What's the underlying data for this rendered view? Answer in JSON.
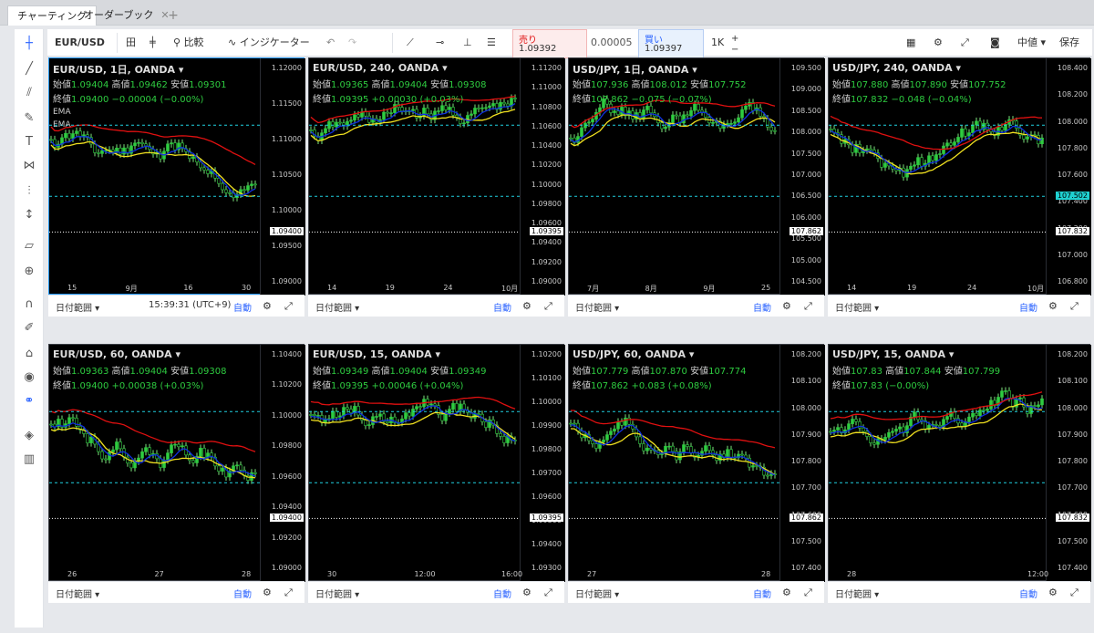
{
  "tabs": [
    {
      "label": "チャーティング",
      "close": ""
    },
    {
      "label": "オーダーブック",
      "close": "✕"
    }
  ],
  "toolbar": {
    "symbol": "EUR/USD",
    "compare": "比較",
    "indicators": "インジケーター",
    "sell_label": "売り",
    "sell_price": "1.09392",
    "spread": "0.00005",
    "buy_label": "買い",
    "buy_price": "1.09397",
    "lot": "1K",
    "price_type": "中値",
    "save": "保存"
  },
  "icons": {
    "crosshair": "crosshair-icon",
    "trendline": "trendline-icon",
    "fib": "fib-icon",
    "brush": "brush-icon",
    "text": "text-icon",
    "pattern": "pattern-icon",
    "projection": "projection-icon",
    "measure": "measure-icon",
    "ruler": "ruler-icon",
    "zoom": "zoom-in-icon",
    "magnet": "magnet-icon",
    "lock-draw": "pencil-lock-icon",
    "lock": "lock-icon",
    "eye": "eye-icon",
    "link": "link-icon",
    "layers": "layers-icon",
    "trash": "trash-icon"
  },
  "panes": [
    {
      "title": "EUR/USD, 1日, OANDA",
      "o": "1.09404",
      "h": "1.09462",
      "l": "1.09301",
      "c": "1.09400",
      "chg": "−0.00004 (−0.00%)",
      "ema1": "EMA",
      "ema2": "EMA",
      "yticks": [
        "1.12000",
        "1.11500",
        "1.11000",
        "1.10500",
        "1.10000",
        "1.09500",
        "1.09000"
      ],
      "xticks": [
        "15",
        "9月",
        "16",
        "30"
      ],
      "last": "1.09400",
      "range": "日付範囲",
      "clock": "15:39:31 (UTC+9)",
      "auto": "自動"
    },
    {
      "title": "EUR/USD, 240, OANDA",
      "o": "1.09365",
      "h": "1.09404",
      "l": "1.09308",
      "c": "1.09395",
      "chg": "+0.00030 (+0.03%)",
      "yticks": [
        "1.11200",
        "1.11000",
        "1.10800",
        "1.10600",
        "1.10400",
        "1.10200",
        "1.10000",
        "1.09800",
        "1.09600",
        "1.09400",
        "1.09200",
        "1.09000"
      ],
      "xticks": [
        "14",
        "19",
        "24",
        "10月"
      ],
      "last": "1.09395",
      "range": "日付範囲",
      "auto": "自動"
    },
    {
      "title": "USD/JPY, 1日, OANDA",
      "o": "107.936",
      "h": "108.012",
      "l": "107.752",
      "c": "107.862",
      "chg": "−0.075 (−0.07%)",
      "yticks": [
        "109.500",
        "109.000",
        "108.500",
        "108.000",
        "107.500",
        "107.000",
        "106.500",
        "106.000",
        "105.500",
        "105.000",
        "104.500"
      ],
      "xticks": [
        "7月",
        "8月",
        "9月",
        "25"
      ],
      "last": "107.862",
      "range": "日付範囲",
      "auto": "自動"
    },
    {
      "title": "USD/JPY, 240, OANDA",
      "o": "107.880",
      "h": "107.890",
      "l": "107.752",
      "c": "107.832",
      "chg": "−0.048 (−0.04%)",
      "yticks": [
        "108.400",
        "108.200",
        "108.000",
        "107.800",
        "107.600",
        "107.400",
        "107.200",
        "107.000",
        "106.800"
      ],
      "xticks": [
        "14",
        "19",
        "24",
        "10月"
      ],
      "last": "107.832",
      "last2": "107.502",
      "range": "日付範囲",
      "auto": "自動"
    },
    {
      "title": "EUR/USD, 60, OANDA",
      "o": "1.09363",
      "h": "1.09404",
      "l": "1.09308",
      "c": "1.09400",
      "chg": "+0.00038 (+0.03%)",
      "yticks": [
        "1.10400",
        "1.10200",
        "1.10000",
        "1.09800",
        "1.09600",
        "1.09400",
        "1.09200",
        "1.09000"
      ],
      "xticks": [
        "26",
        "27",
        "28"
      ],
      "last": "1.09400",
      "range": "日付範囲",
      "auto": "自動"
    },
    {
      "title": "EUR/USD, 15, OANDA",
      "o": "1.09349",
      "h": "1.09404",
      "l": "1.09349",
      "c": "1.09395",
      "chg": "+0.00046 (+0.04%)",
      "yticks": [
        "1.10200",
        "1.10100",
        "1.10000",
        "1.09900",
        "1.09800",
        "1.09700",
        "1.09600",
        "1.09500",
        "1.09400",
        "1.09300"
      ],
      "xticks": [
        "30",
        "12:00",
        "16:00"
      ],
      "last": "1.09395",
      "range": "日付範囲",
      "auto": "自動"
    },
    {
      "title": "USD/JPY, 60, OANDA",
      "o": "107.779",
      "h": "107.870",
      "l": "107.774",
      "c": "107.862",
      "chg": "+0.083 (+0.08%)",
      "yticks": [
        "108.200",
        "108.100",
        "108.000",
        "107.900",
        "107.800",
        "107.700",
        "107.600",
        "107.500",
        "107.400"
      ],
      "xticks": [
        "27",
        "28"
      ],
      "last": "107.862",
      "range": "日付範囲",
      "auto": "自動"
    },
    {
      "title": "USD/JPY, 15, OANDA",
      "o": "107.83",
      "h": "107.844",
      "l": "107.799",
      "c": "107.83",
      "chg": "(−0.00%)",
      "yticks": [
        "108.200",
        "108.100",
        "108.000",
        "107.900",
        "107.800",
        "107.700",
        "107.600",
        "107.500",
        "107.400"
      ],
      "xticks": [
        "28",
        "12:00"
      ],
      "last": "107.832",
      "range": "日付範囲",
      "auto": "自動"
    }
  ],
  "labels": {
    "open": "始値",
    "high": "高値",
    "low": "安値",
    "close": "終値"
  },
  "colors": {
    "green": "#2ecc40",
    "red": "#e01010",
    "yellow": "#f0e020",
    "blue": "#1030e0",
    "cyan": "#20d0e0",
    "accent": "#2962ff"
  }
}
